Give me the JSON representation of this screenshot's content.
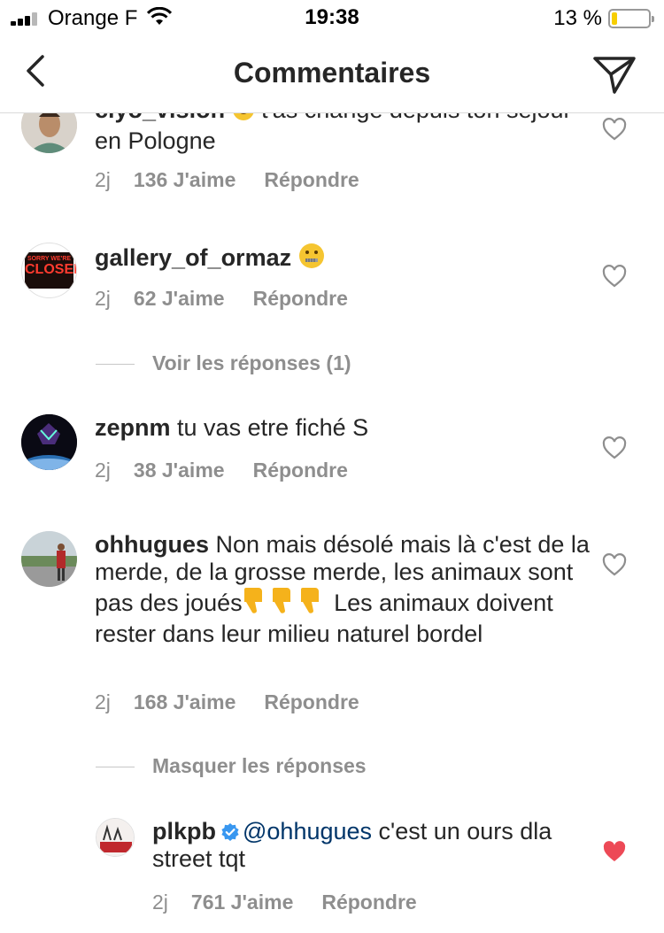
{
  "status_bar": {
    "carrier": "Orange F",
    "time": "19:38",
    "battery": "13 %",
    "battery_level": 0.13
  },
  "header": {
    "title": "Commentaires"
  },
  "comments": [
    {
      "username": "clyo_vision",
      "text": "t'as changé depuis ton séjour en Pologne",
      "age": "2j",
      "likes": "136 J'aime",
      "reply": "Répondre"
    },
    {
      "username": "gallery_of_ormaz",
      "text": "",
      "age": "2j",
      "likes": "62 J'aime",
      "reply": "Répondre",
      "avatar_text": [
        "SORRY WE'RE",
        "CLOSED"
      ],
      "thread_toggle": "Voir les réponses (1)"
    },
    {
      "username": "zepnm",
      "text": "tu vas etre fiché S",
      "age": "2j",
      "likes": "38 J'aime",
      "reply": "Répondre"
    },
    {
      "username": "ohhugues",
      "text_a": "Non mais désolé mais là c'est de la merde, de la grosse merde, les animaux sont pas des joués",
      "text_b": "Les animaux doivent rester dans leur milieu naturel bordel",
      "age": "2j",
      "likes": "168 J'aime",
      "reply": "Répondre",
      "thread_toggle": "Masquer les réponses"
    }
  ],
  "reply": {
    "username": "plkpb",
    "mention": "@ohhugues",
    "text": "c'est un ours dla street tqt",
    "age": "2j",
    "likes": "761 J'aime",
    "reply": "Répondre",
    "liked": true
  },
  "colors": {
    "text": "#262626",
    "meta": "#8e8e8e",
    "mention": "#003569",
    "like_red": "#ed4956",
    "verified_blue": "#3897f0",
    "battery_yellow": "#f7ce00"
  },
  "icons": [
    "back-chevron-icon",
    "send-icon",
    "heart-icon",
    "verified-badge-icon",
    "wifi-icon",
    "signal-icon",
    "battery-icon"
  ]
}
